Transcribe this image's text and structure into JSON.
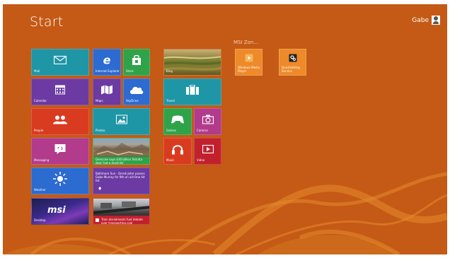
{
  "start": {
    "title": "Start"
  },
  "user": {
    "name": "Gabe"
  },
  "group": {
    "label": "MSI Zon..."
  },
  "tiles": {
    "mail": "Mail",
    "ie": "Internet Explorer",
    "store": "Store",
    "calendar": "Calendar",
    "maps": "Maps",
    "skydrive": "SkyDrive",
    "people": "People",
    "photos": "Photos",
    "messaging": "Messaging",
    "finance_news": "Glencore says $30 billion Xstrata deal 'not a must-do'",
    "weather": "Weather",
    "sports_news": "Baltimore Sun - Derek Jeter passes Gabe Murray for 9th on all-time hit list",
    "desktop": "Desktop",
    "msi_logo": "msi",
    "news_headline": "Train derailments fuel debate over transporting coal",
    "bing": "Bing",
    "travel": "Travel",
    "games": "Games",
    "camera": "Camera",
    "music": "Music",
    "video": "Video",
    "wmp_line1": "Windows Media",
    "wmp_line2": "Player",
    "qs_line1": "QuickSetting",
    "qs_line2": "Service"
  },
  "colors": {
    "background": "#c45a15",
    "teal": "#1e96a6",
    "blue": "#2c6bd0",
    "green": "#2fa34a",
    "purple": "#6b3aa3",
    "red": "#d93b21",
    "magenta": "#b23b8c",
    "crimson": "#c3202e",
    "orange": "#ee8a2a"
  }
}
